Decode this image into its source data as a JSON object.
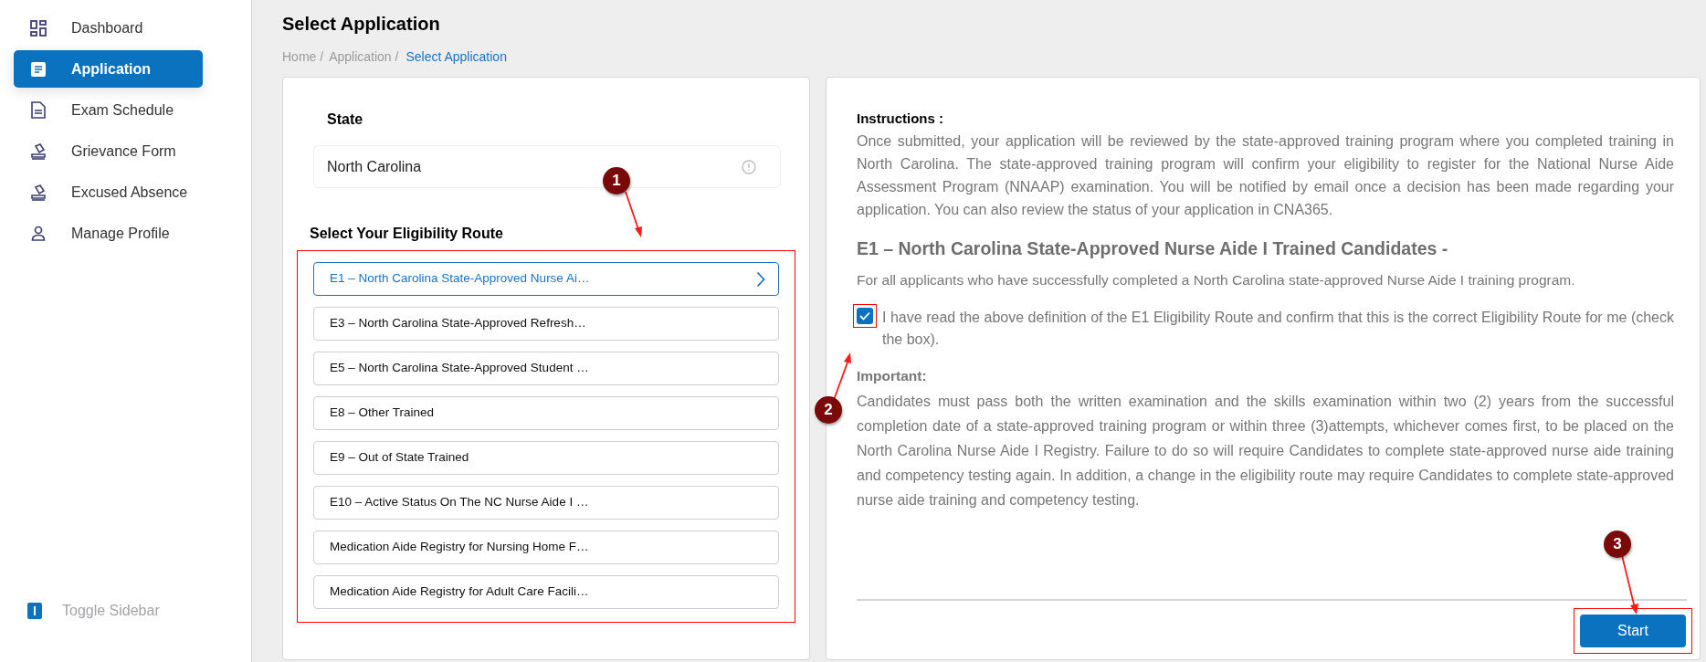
{
  "sidebar": {
    "items": [
      {
        "label": "Dashboard",
        "kind": "dashboard",
        "selected": false
      },
      {
        "label": "Application",
        "kind": "application",
        "selected": true
      },
      {
        "label": "Exam Schedule",
        "kind": "document",
        "selected": false
      },
      {
        "label": "Grievance Form",
        "kind": "stamp",
        "selected": false
      },
      {
        "label": "Excused Absence",
        "kind": "stamp",
        "selected": false
      },
      {
        "label": "Manage Profile",
        "kind": "person",
        "selected": false
      }
    ],
    "toggle": {
      "label": "Toggle Sidebar"
    }
  },
  "page": {
    "title": "Select Application",
    "breadcrumb": [
      {
        "label": "Home /",
        "current": false
      },
      {
        "label": "Application /",
        "current": false
      },
      {
        "label": "Select Application",
        "current": true
      }
    ]
  },
  "state": {
    "label": "State",
    "value": "North Carolina"
  },
  "routes": {
    "title": "Select Your Eligibility Route",
    "items": [
      {
        "label": "E1 – North Carolina State-Approved Nurse Ai…",
        "selected": true
      },
      {
        "label": "E3 – North Carolina State-Approved Refresh…",
        "selected": false
      },
      {
        "label": "E5 – North Carolina State-Approved Student …",
        "selected": false
      },
      {
        "label": "E8 – Other Trained",
        "selected": false
      },
      {
        "label": "E9 – Out of State Trained",
        "selected": false
      },
      {
        "label": "E10 – Active Status On The NC Nurse Aide I …",
        "selected": false
      },
      {
        "label": "Medication Aide Registry for Nursing Home F…",
        "selected": false
      },
      {
        "label": "Medication Aide Registry for Adult Care Facili…",
        "selected": false
      }
    ]
  },
  "details": {
    "instructions_title": "Instructions :",
    "instructions": "Once submitted, your application will be reviewed by the state-approved training program where you completed training in North Carolina. The state-approved training program will confirm your eligibility to register for the National Nurse Aide Assessment Program (NNAAP) examination. You will be notified by email once a decision has been made regarding your application. You can also review the status of your application in CNA365.",
    "route_title": "E1 – North Carolina State-Approved Nurse Aide I Trained Candidates -",
    "route_description": "For all applicants who have successfully completed a North Carolina state-approved Nurse Aide I training program.",
    "confirm": {
      "label": "I have read the above definition of the E1 Eligibility Route and confirm that this is the correct Eligibility Route for me (check the box).",
      "checked": true
    },
    "important_title": "Important:",
    "important": "Candidates must pass both the written examination and the skills examination within two (2) years from the successful completion date of a state-approved training program or within three (3)attempts, whichever comes first, to be placed on the North Carolina Nurse Aide I Registry. Failure to do so will require Candidates to complete state-approved nurse aide training and competency testing again. In addition, a change in the eligibility route may require Candidates to complete state-approved nurse aide training and competency testing.",
    "button": "Start"
  },
  "annotations": [
    "1",
    "2",
    "3"
  ]
}
